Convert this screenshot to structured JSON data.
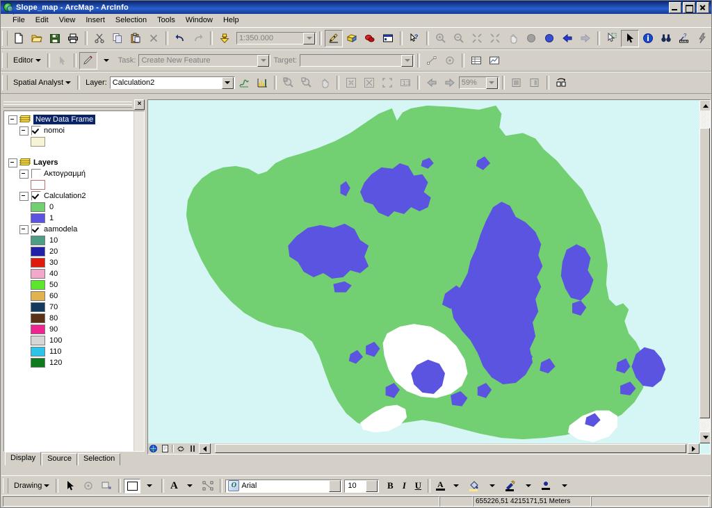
{
  "window": {
    "title": "Slope_map - ArcMap - ArcInfo",
    "app_icon": "arcmap-globe-icon",
    "minimize_label": "Minimize",
    "maximize_label": "Restore",
    "close_label": "Close"
  },
  "menubar": {
    "items": [
      "File",
      "Edit",
      "View",
      "Insert",
      "Selection",
      "Tools",
      "Window",
      "Help"
    ]
  },
  "standard_toolbar": {
    "buttons": [
      {
        "name": "new-document-icon",
        "tip": "New"
      },
      {
        "name": "open-folder-icon",
        "tip": "Open"
      },
      {
        "name": "save-icon",
        "tip": "Save"
      },
      {
        "name": "print-icon",
        "tip": "Print"
      },
      {
        "name": "cut-scissors-icon",
        "tip": "Cut"
      },
      {
        "name": "copy-icon",
        "tip": "Copy"
      },
      {
        "name": "paste-clipboard-icon",
        "tip": "Paste"
      },
      {
        "name": "delete-x-icon",
        "tip": "Delete"
      },
      {
        "name": "undo-arrow-icon",
        "tip": "Undo"
      },
      {
        "name": "redo-arrow-icon",
        "tip": "Redo"
      },
      {
        "name": "add-data-icon",
        "tip": "Add Data"
      }
    ],
    "scale": {
      "value": "1:350.000",
      "label": "Map Scale"
    },
    "right_buttons": [
      {
        "name": "editor-toolbar-icon",
        "tip": "Editor Toolbar"
      },
      {
        "name": "toolbox-icon",
        "tip": "ArcToolbox"
      },
      {
        "name": "model-builder-icon",
        "tip": "Model Builder"
      },
      {
        "name": "command-line-icon",
        "tip": "Show Command Line Window"
      },
      {
        "name": "whats-this-help-icon",
        "tip": "What's This?"
      }
    ],
    "tools": [
      {
        "name": "zoom-in-icon",
        "tip": "Zoom In"
      },
      {
        "name": "zoom-out-icon",
        "tip": "Zoom Out"
      },
      {
        "name": "fixed-zoom-in-icon",
        "tip": "Fixed Zoom In"
      },
      {
        "name": "fixed-zoom-out-icon",
        "tip": "Fixed Zoom Out"
      },
      {
        "name": "pan-hand-icon",
        "tip": "Pan"
      },
      {
        "name": "full-extent-icon",
        "tip": "Full Extent"
      },
      {
        "name": "previous-extent-icon",
        "tip": "Go Back To Previous Extent"
      },
      {
        "name": "back-arrow-icon",
        "tip": "Back"
      },
      {
        "name": "forward-arrow-icon",
        "tip": "Forward"
      },
      {
        "name": "select-features-icon",
        "tip": "Select Features"
      },
      {
        "name": "select-elements-arrow-icon",
        "tip": "Select Elements"
      },
      {
        "name": "identify-icon",
        "tip": "Identify"
      },
      {
        "name": "find-binoculars-icon",
        "tip": "Find"
      },
      {
        "name": "measure-icon",
        "tip": "Measure"
      },
      {
        "name": "hyperlink-lightning-icon",
        "tip": "Hyperlink"
      }
    ]
  },
  "editor_toolbar": {
    "menu_label": "Editor",
    "edit_tool_name": "edit-pencil-icon",
    "task_label": "Task:",
    "task_value": "Create New Feature",
    "target_label": "Target:",
    "target_value": "",
    "buttons": [
      {
        "name": "edit-sketch-tool-icon",
        "tip": "Sketch Tool"
      },
      {
        "name": "edit-vertex-tool-icon",
        "tip": "Edit Vertices"
      },
      {
        "name": "attributes-table-icon",
        "tip": "Attributes"
      },
      {
        "name": "sketch-properties-icon",
        "tip": "Sketch Properties"
      }
    ]
  },
  "spatial_analyst_toolbar": {
    "menu_label": "Spatial Analyst",
    "layer_label": "Layer:",
    "layer_value": "Calculation2",
    "buttons": [
      {
        "name": "histogram-icon",
        "tip": "Histogram"
      },
      {
        "name": "raster-chart-icon",
        "tip": "Raster Calculator"
      }
    ]
  },
  "raster_toolbar": {
    "zoom_value": "59%",
    "buttons": [
      {
        "name": "zoom-in-image-icon",
        "tip": "Zoom In"
      },
      {
        "name": "zoom-out-image-icon",
        "tip": "Zoom Out"
      },
      {
        "name": "pan-image-icon",
        "tip": "Pan"
      },
      {
        "name": "fit-to-display-icon",
        "tip": "Fit To Display"
      },
      {
        "name": "fit-to-window-icon",
        "tip": "Fit To Window"
      },
      {
        "name": "actual-extent-icon",
        "tip": "Actual Extent"
      },
      {
        "name": "one-to-one-icon",
        "tip": "1:1 Zoom"
      },
      {
        "name": "previous-image-icon",
        "tip": "Previous Image"
      },
      {
        "name": "next-image-icon",
        "tip": "Next Image"
      },
      {
        "name": "flicker-icon",
        "tip": "Flicker"
      },
      {
        "name": "swipe-icon",
        "tip": "Swipe"
      },
      {
        "name": "image-analysis-icon",
        "tip": "Image Analysis"
      }
    ]
  },
  "toc": {
    "close_label": "×",
    "nodes": [
      {
        "type": "dataframe",
        "name": "New Data Frame",
        "selected": true,
        "expanded": true,
        "icon": "layers-stack-icon",
        "children": [
          {
            "type": "layer",
            "name": "nomoi",
            "checked": true,
            "expanded": true,
            "symbols": [
              {
                "label": "",
                "color": "#f7f3d8",
                "outline": "#8a8a6a"
              }
            ]
          }
        ]
      },
      {
        "type": "dataframe",
        "name": "Layers",
        "selected": false,
        "expanded": true,
        "icon": "layers-stack-icon",
        "children": [
          {
            "type": "layer",
            "name": "Ακτογραμμή",
            "checked": false,
            "expanded": true,
            "symbols": [
              {
                "label": "",
                "color": "#ffffff",
                "outline": "#c07070"
              }
            ]
          },
          {
            "type": "layer",
            "name": "Calculation2",
            "checked": true,
            "expanded": true,
            "symbols": [
              {
                "label": "0",
                "color": "#72d072",
                "outline": "#7a7a7a"
              },
              {
                "label": "1",
                "color": "#5a54e0",
                "outline": "#7a7a7a"
              }
            ]
          },
          {
            "type": "layer",
            "name": "aamodela",
            "checked": true,
            "expanded": true,
            "symbols": [
              {
                "label": "10",
                "color": "#4d9e85",
                "outline": "#7a7a7a"
              },
              {
                "label": "20",
                "color": "#2020a8",
                "outline": "#7a7a7a"
              },
              {
                "label": "30",
                "color": "#e11b0c",
                "outline": "#7a7a7a"
              },
              {
                "label": "40",
                "color": "#f2a8c8",
                "outline": "#7a7a7a"
              },
              {
                "label": "50",
                "color": "#5ce62e",
                "outline": "#7a7a7a"
              },
              {
                "label": "60",
                "color": "#e0b250",
                "outline": "#7a7a7a"
              },
              {
                "label": "70",
                "color": "#143a5e",
                "outline": "#7a7a7a"
              },
              {
                "label": "80",
                "color": "#5c3217",
                "outline": "#7a7a7a"
              },
              {
                "label": "90",
                "color": "#ee2590",
                "outline": "#7a7a7a"
              },
              {
                "label": "100",
                "color": "#d6d6d6",
                "outline": "#7a7a7a"
              },
              {
                "label": "110",
                "color": "#2ec3e8",
                "outline": "#7a7a7a"
              },
              {
                "label": "120",
                "color": "#0e7a1e",
                "outline": "#7a7a7a"
              }
            ]
          }
        ]
      }
    ],
    "tabs": [
      {
        "label": "Display",
        "active": true
      },
      {
        "label": "Source",
        "active": false
      },
      {
        "label": "Selection",
        "active": false
      }
    ]
  },
  "map": {
    "background_color": "#d6f5f5",
    "land_color": "#72d072",
    "highlight_color": "#5a54e0",
    "lake_color": "#ffffff",
    "status_buttons": [
      {
        "name": "globe-icon",
        "tip": "Data View"
      },
      {
        "name": "page-layout-icon",
        "tip": "Layout View"
      },
      {
        "name": "refresh-icon",
        "tip": "Refresh View"
      },
      {
        "name": "pause-drawing-icon",
        "tip": "Pause Drawing"
      },
      {
        "name": "toggle-toc-icon",
        "tip": "Toggle Table of Contents"
      }
    ]
  },
  "drawing_toolbar": {
    "menu_label": "Drawing",
    "buttons": [
      {
        "name": "select-elements-arrow-icon",
        "tip": "Select Elements"
      },
      {
        "name": "rotate-icon",
        "tip": "Rotate"
      },
      {
        "name": "new-rectangle-icon",
        "tip": "New Rectangle"
      }
    ],
    "fill_swatch_name": "fill-color-swatch",
    "text_tool_name": "new-text-icon",
    "graphic_tool_name": "edit-vertices-icon",
    "font_family": "Arial",
    "font_size": "10",
    "bold_label": "B",
    "italic_label": "I",
    "underline_label": "U",
    "color_buttons": [
      {
        "name": "font-color-icon",
        "tip": "Font Color"
      },
      {
        "name": "fill-color-icon",
        "tip": "Fill Color"
      },
      {
        "name": "line-color-icon",
        "tip": "Line Color"
      },
      {
        "name": "marker-color-icon",
        "tip": "Marker Color"
      }
    ]
  },
  "statusbar": {
    "coordinates": "655226,51  4215171,51 Meters",
    "message": ""
  }
}
